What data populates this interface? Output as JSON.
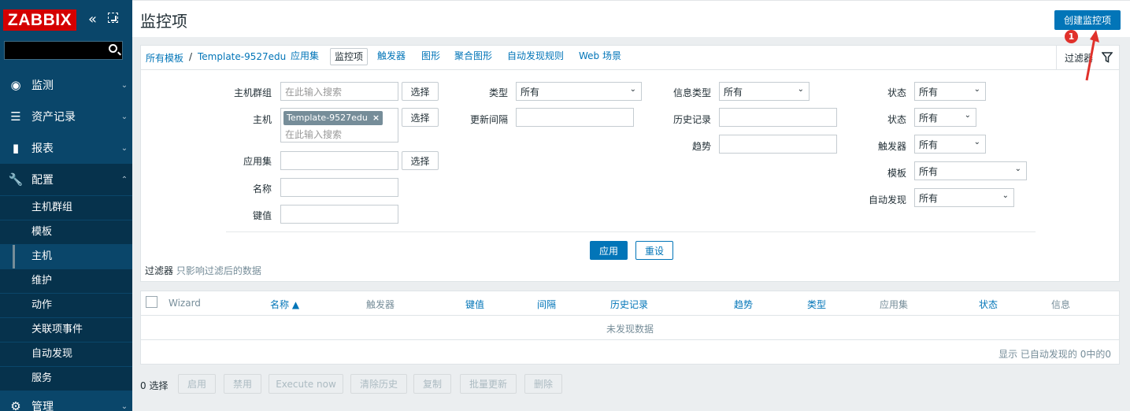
{
  "brand": {
    "logo": "ZABBIX"
  },
  "sidebar": {
    "collapse_glyph": "«",
    "menu": [
      {
        "label": "监测",
        "icon": "eye-icon",
        "glyph": "◉"
      },
      {
        "label": "资产记录",
        "icon": "list-icon",
        "glyph": "☰"
      },
      {
        "label": "报表",
        "icon": "bar-chart-icon",
        "glyph": "▮"
      },
      {
        "label": "配置",
        "icon": "wrench-icon",
        "glyph": "🔧"
      },
      {
        "label": "管理",
        "icon": "gear-icon",
        "glyph": "⚙"
      }
    ],
    "submenu": [
      "主机群组",
      "模板",
      "主机",
      "维护",
      "动作",
      "关联项事件",
      "自动发现",
      "服务"
    ],
    "selected_submenu": "主机"
  },
  "header": {
    "title": "监控项",
    "create_button": "创建监控项"
  },
  "nav": {
    "crumb_all_templates": "所有模板",
    "crumb_sep": "/",
    "crumb_template": "Template-9527edu",
    "tabs": [
      "应用集",
      "监控项",
      "触发器",
      "图形",
      "聚合图形",
      "自动发现规则",
      "Web 场景"
    ],
    "active_tab": "监控项",
    "filter_tab": "过滤器"
  },
  "filter": {
    "host_group_label": "主机群组",
    "host_label": "主机",
    "application_label": "应用集",
    "name_label": "名称",
    "key_label": "键值",
    "search_placeholder": "在此输入搜索",
    "select_button": "选择",
    "host_tag": "Template-9527edu",
    "type_label": "类型",
    "type_value": "所有",
    "update_interval_label": "更新间隔",
    "info_type_label": "信息类型",
    "info_type_value": "所有",
    "history_label": "历史记录",
    "trends_label": "趋势",
    "state_label": "状态",
    "state_value": "所有",
    "status_label": "状态",
    "status_value": "所有",
    "triggers_label": "触发器",
    "triggers_value": "所有",
    "template_label": "模板",
    "template_value": "所有",
    "discovery_label": "自动发现",
    "discovery_value": "所有",
    "apply_button": "应用",
    "reset_button": "重设",
    "note_title": "过滤器",
    "note_text": "只影响过滤后的数据"
  },
  "table": {
    "columns": [
      "Wizard",
      "名称 ▲",
      "触发器",
      "键值",
      "间隔",
      "历史记录",
      "趋势",
      "类型",
      "应用集",
      "状态",
      "信息"
    ],
    "empty_text": "未发现数据",
    "footer": "显示 已自动发现的 0中的0"
  },
  "actions": {
    "selected_count": "0 选择",
    "buttons": [
      "启用",
      "禁用",
      "Execute now",
      "清除历史",
      "复制",
      "批量更新",
      "删除"
    ]
  },
  "annotation": {
    "badge": "1",
    "color": "#e0312b"
  },
  "colors": {
    "sidebar": "#0a466a",
    "primary": "#0275b8",
    "logo": "#d40000"
  }
}
